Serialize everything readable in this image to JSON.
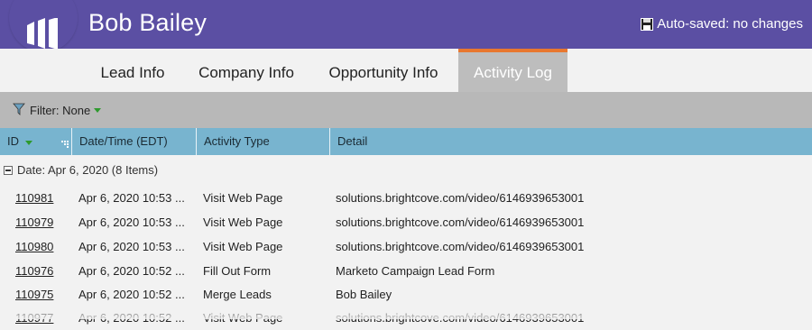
{
  "header": {
    "lead_name": "Bob Bailey",
    "autosave": "Auto-saved: no changes",
    "bg_color": "#5b4fa3"
  },
  "tabs": [
    {
      "label": "Lead Info",
      "active": false
    },
    {
      "label": "Company Info",
      "active": false
    },
    {
      "label": "Opportunity Info",
      "active": false
    },
    {
      "label": "Activity Log",
      "active": true
    }
  ],
  "accent_color": "#e8772f",
  "filter": {
    "label": "Filter: None"
  },
  "columns": [
    "ID",
    "Date/Time (EDT)",
    "Activity Type",
    "Detail"
  ],
  "group": {
    "label": "Date: Apr 6, 2020 (8 Items)"
  },
  "rows": [
    {
      "id": "110981",
      "date": "Apr 6, 2020 10:53 ...",
      "type": "Visit Web Page",
      "detail": "solutions.brightcove.com/video/6146939653001"
    },
    {
      "id": "110979",
      "date": "Apr 6, 2020 10:53 ...",
      "type": "Visit Web Page",
      "detail": "solutions.brightcove.com/video/6146939653001"
    },
    {
      "id": "110980",
      "date": "Apr 6, 2020 10:53 ...",
      "type": "Visit Web Page",
      "detail": "solutions.brightcove.com/video/6146939653001"
    },
    {
      "id": "110976",
      "date": "Apr 6, 2020 10:52 ...",
      "type": "Fill Out Form",
      "detail": "Marketo Campaign Lead Form"
    },
    {
      "id": "110975",
      "date": "Apr 6, 2020 10:52 ...",
      "type": "Merge Leads",
      "detail": "Bob Bailey"
    },
    {
      "id": "110977",
      "date": "Apr 6, 2020 10:52 ...",
      "type": "Visit Web Page",
      "detail": "solutions.brightcove.com/video/6146939653001"
    }
  ]
}
